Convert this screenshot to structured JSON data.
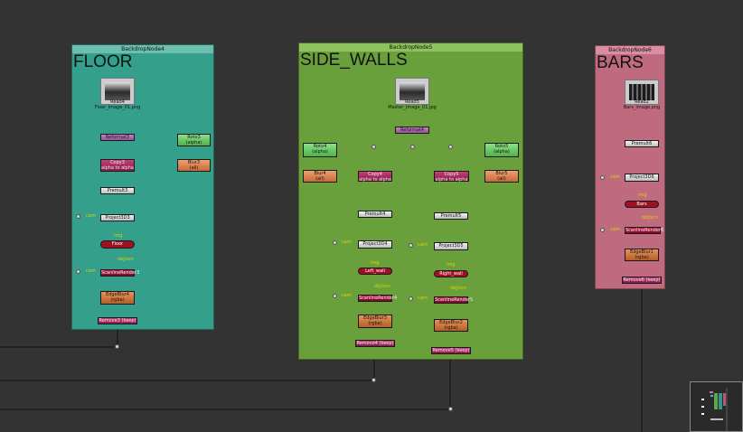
{
  "backdrops": {
    "floor": {
      "header": "BackdropNode4",
      "label": "FLOOR",
      "color": "#34a08c"
    },
    "side_walls": {
      "header": "BackdropNode5",
      "label": "SIDE_WALLS",
      "color": "#6aa03c"
    },
    "bars": {
      "header": "BackdropNode6",
      "label": "BARS",
      "color": "#c06a80"
    }
  },
  "floor_nodes": {
    "read_name": "Read4",
    "read_file": "Floor_Image_01.png",
    "reformat": "Reformat3",
    "roto_name": "Roto3",
    "roto_sub": "(alpha)",
    "copy_name": "Copy3",
    "copy_sub": "alpha to alpha",
    "blur_name": "Blur3",
    "blur_sub": "(all)",
    "premult": "Premult3",
    "project": "Project3D3",
    "card": "Floor",
    "scanline": "ScanlineRender3",
    "edge_name": "EdgeBlur4",
    "edge_sub": "(rgba)",
    "remove": "Remove3 (keep)"
  },
  "wall_nodes": {
    "read_name": "Read5",
    "read_file": "Master_Image_01.jpg",
    "reformat": "Reformat4",
    "roto_left_name": "Roto4",
    "roto_left_sub": "(alpha)",
    "roto_right_name": "Roto5",
    "roto_right_sub": "(alpha)",
    "blur_left_name": "Blur4",
    "blur_left_sub": "(all)",
    "blur_right_name": "Blur5",
    "blur_right_sub": "(all)",
    "copy_left_name": "Copy4",
    "copy_left_sub": "alpha to alpha",
    "copy_right_name": "Copy5",
    "copy_right_sub": "alpha to alpha",
    "premult_left": "Premult4",
    "premult_right": "Premult5",
    "project_left": "Project3D4",
    "project_right": "Project3D5",
    "card_left": "Left_wall",
    "card_right": "Right_wall",
    "scan_left": "ScanlineRender4",
    "scan_right": "ScanlineRender5",
    "edge_left_name": "EdgeBlur3",
    "edge_left_sub": "(rgba)",
    "edge_right_name": "EdgeBlur2",
    "edge_right_sub": "(rgba)",
    "remove_left": "Remove4 (keep)",
    "remove_right": "Remove5 (keep)"
  },
  "bar_nodes": {
    "read_name": "Read2",
    "read_file": "Bars_Image.png",
    "premult": "Premult6",
    "project": "Project3D6",
    "card": "Bars",
    "scanline": "ScanlineRender6",
    "edge_name": "EdgeBlur1",
    "edge_sub": "(rgba)",
    "remove": "Remove6 (keep)"
  },
  "pipe_labels": {
    "cam": "cam",
    "img": "img",
    "obj_scn": "obj/scn"
  }
}
